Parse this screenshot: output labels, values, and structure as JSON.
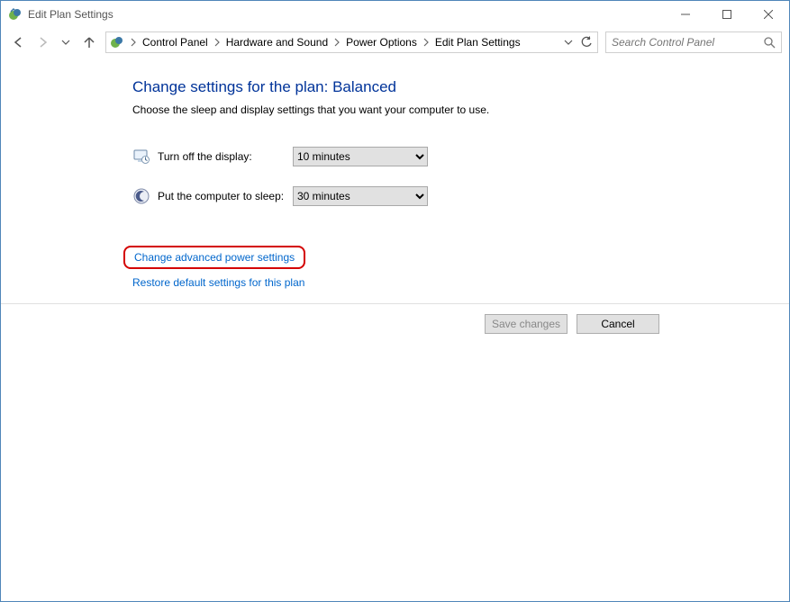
{
  "window": {
    "title": "Edit Plan Settings"
  },
  "breadcrumbs": {
    "items": [
      "Control Panel",
      "Hardware and Sound",
      "Power Options",
      "Edit Plan Settings"
    ]
  },
  "search": {
    "placeholder": "Search Control Panel"
  },
  "page": {
    "heading": "Change settings for the plan: Balanced",
    "subtext": "Choose the sleep and display settings that you want your computer to use.",
    "display_label": "Turn off the display:",
    "display_value": "10 minutes",
    "sleep_label": "Put the computer to sleep:",
    "sleep_value": "30 minutes",
    "advanced_link": "Change advanced power settings",
    "restore_link": "Restore default settings for this plan"
  },
  "footer": {
    "save": "Save changes",
    "cancel": "Cancel"
  }
}
